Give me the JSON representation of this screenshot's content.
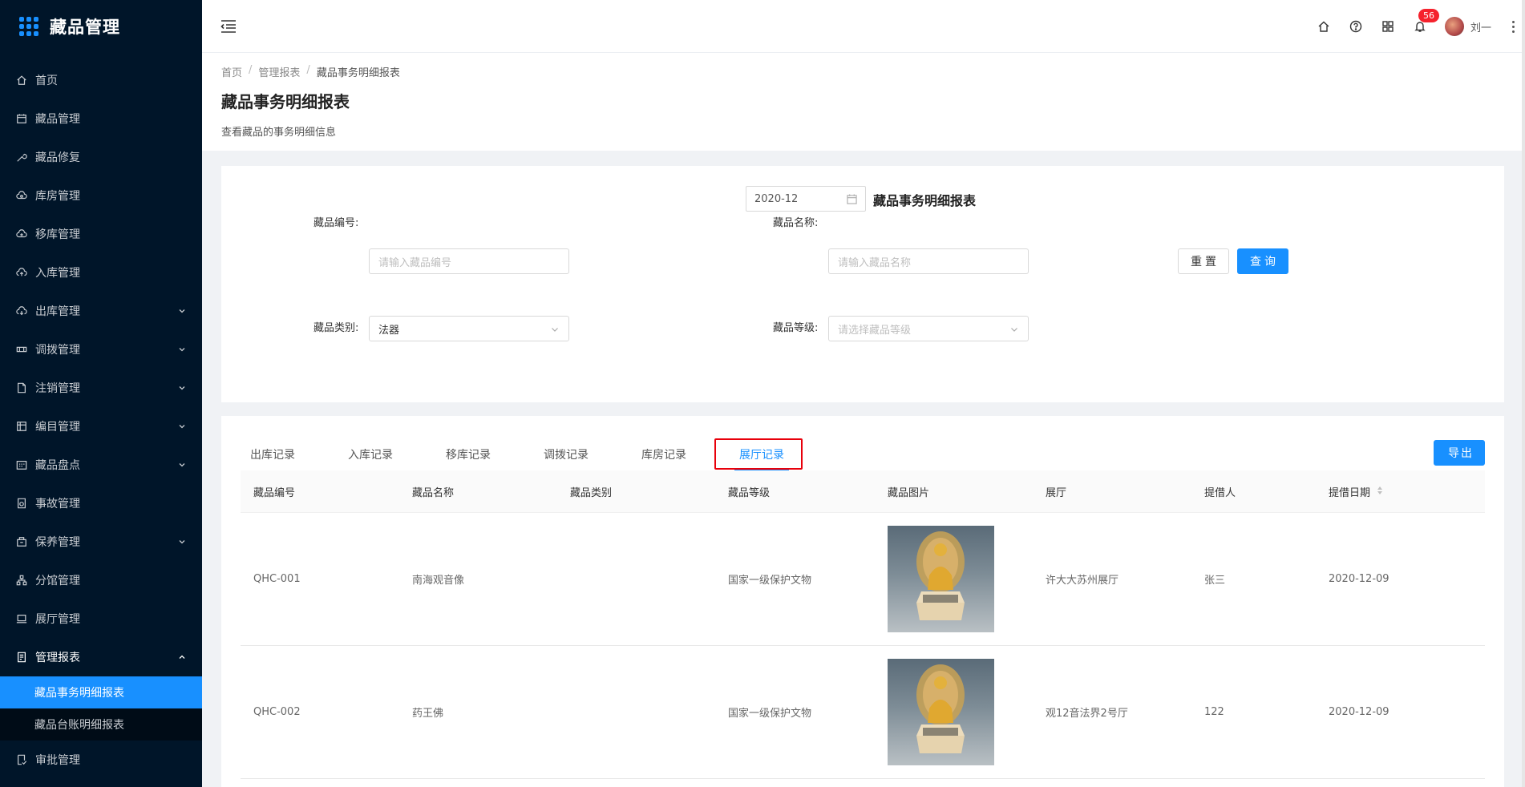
{
  "app": {
    "title": "藏品管理"
  },
  "sidebar": {
    "items": [
      {
        "label": "首页",
        "icon": "home-icon"
      },
      {
        "label": "藏品管理",
        "icon": "calendar-icon"
      },
      {
        "label": "藏品修复",
        "icon": "wrench-icon"
      },
      {
        "label": "库房管理",
        "icon": "cloud-icon"
      },
      {
        "label": "移库管理",
        "icon": "cloud-sync-icon"
      },
      {
        "label": "入库管理",
        "icon": "cloud-upload-icon"
      },
      {
        "label": "出库管理",
        "icon": "cloud-download-icon",
        "expandable": true
      },
      {
        "label": "调拨管理",
        "icon": "transfer-icon",
        "expandable": true
      },
      {
        "label": "注销管理",
        "icon": "file-icon",
        "expandable": true
      },
      {
        "label": "编目管理",
        "icon": "catalog-icon",
        "expandable": true
      },
      {
        "label": "藏品盘点",
        "icon": "inventory-icon",
        "expandable": true
      },
      {
        "label": "事故管理",
        "icon": "accident-icon"
      },
      {
        "label": "保养管理",
        "icon": "maintenance-icon",
        "expandable": true
      },
      {
        "label": "分馆管理",
        "icon": "cluster-icon"
      },
      {
        "label": "展厅管理",
        "icon": "laptop-icon"
      },
      {
        "label": "管理报表",
        "icon": "report-icon",
        "expandable": true,
        "open": true
      }
    ],
    "submenu": [
      {
        "label": "藏品事务明细报表",
        "active": true
      },
      {
        "label": "藏品台账明细报表",
        "active": false
      }
    ],
    "after": [
      {
        "label": "审批管理",
        "icon": "audit-icon"
      }
    ]
  },
  "header": {
    "notification_count": "56",
    "username": "刘一",
    "icons": [
      "home-icon",
      "help-icon",
      "apps-icon",
      "bell-icon"
    ]
  },
  "breadcrumb": [
    "首页",
    "管理报表",
    "藏品事务明细报表"
  ],
  "page": {
    "title": "藏品事务明细报表",
    "description": "查看藏品的事务明细信息"
  },
  "filters": {
    "month": "2020-12",
    "report_title": "藏品事务明细报表",
    "code_label": "藏品编号:",
    "code_placeholder": "请输入藏品编号",
    "name_label": "藏品名称:",
    "name_placeholder": "请输入藏品名称",
    "category_label": "藏品类别:",
    "category_value": "法器",
    "grade_label": "藏品等级:",
    "grade_placeholder": "请选择藏品等级",
    "reset_label": "重置",
    "search_label": "查询"
  },
  "tabs": [
    {
      "label": "出库记录"
    },
    {
      "label": "入库记录"
    },
    {
      "label": "移库记录"
    },
    {
      "label": "调拨记录"
    },
    {
      "label": "库房记录"
    },
    {
      "label": "展厅记录",
      "active": true
    }
  ],
  "export_label": "导出",
  "table": {
    "columns": [
      "藏品编号",
      "藏品名称",
      "藏品类别",
      "藏品等级",
      "藏品图片",
      "展厅",
      "提借人",
      "提借日期"
    ],
    "rows": [
      {
        "code": "QHC-001",
        "name": "南海观音像",
        "category": "",
        "grade": "国家一级保护文物",
        "hall": "许大大苏州展厅",
        "borrower": "张三",
        "date": "2020-12-09"
      },
      {
        "code": "QHC-002",
        "name": "药王佛",
        "category": "",
        "grade": "国家一级保护文物",
        "hall": "观12音法界2号厅",
        "borrower": "122",
        "date": "2020-12-09"
      }
    ]
  },
  "colors": {
    "primary": "#1890ff",
    "sidebar_bg": "#001529",
    "highlight_red": "#e8000b",
    "badge": "#f5222d"
  }
}
